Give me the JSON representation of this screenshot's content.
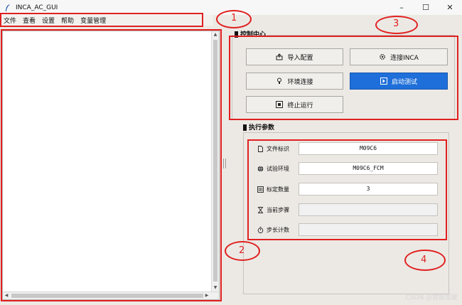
{
  "window": {
    "title": "INCA_AC_GUI",
    "controls": {
      "minimize": "–",
      "maximize": "☐",
      "close": "✕"
    }
  },
  "menu": {
    "items": [
      "文件",
      "查看",
      "设置",
      "帮助",
      "变量管理"
    ]
  },
  "control_center": {
    "title": "控制中心",
    "buttons": {
      "import_config": "导入配置",
      "connect_inca": "连接INCA",
      "env_connect": "环境连接",
      "start_test": "启动测试",
      "stop_run": "终止运行"
    }
  },
  "exec_params": {
    "title": "执行参数",
    "rows": [
      {
        "label": "文件标识",
        "value": ""
      },
      {
        "label": "试验环境",
        "value": "M09C6_FCM"
      },
      {
        "label": "标定数量",
        "value": "3"
      },
      {
        "label": "当前步骤",
        "value": ""
      },
      {
        "label": "步长计数",
        "value": ""
      }
    ],
    "file_id_value": "M09C6"
  },
  "annotations": [
    "1",
    "2",
    "3",
    "4"
  ],
  "watermark": "CSDN @智能驾驶",
  "colors": {
    "accent": "#1e6fd9",
    "annotation": "#e02020"
  }
}
